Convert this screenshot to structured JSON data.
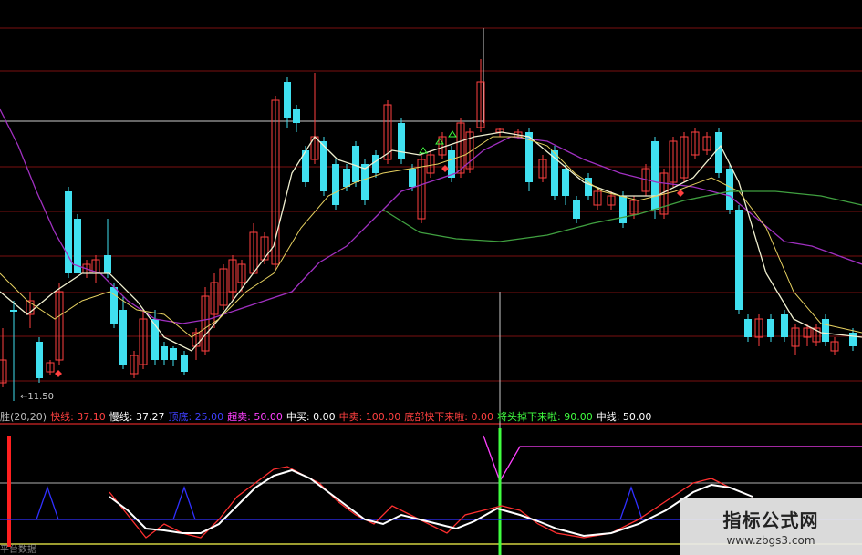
{
  "chart_data": {
    "type": "candlestick",
    "price_tag": "←11.50",
    "indicator_legend": [
      {
        "text": "胜(20,20)",
        "color": "#bbbbbb"
      },
      {
        "text": "快线: 37.10",
        "color": "#ff4040"
      },
      {
        "text": "慢线: 37.27",
        "color": "#ffffff"
      },
      {
        "text": "顶底: 25.00",
        "color": "#4040ff"
      },
      {
        "text": "超卖: 50.00",
        "color": "#ff40ff"
      },
      {
        "text": "中买: 0.00",
        "color": "#ffffff"
      },
      {
        "text": "中卖: 100.00",
        "color": "#ff4040"
      },
      {
        "text": "底部快下来啦: 0.00",
        "color": "#ff4040"
      },
      {
        "text": "将头掉下来啦: 90.00",
        "color": "#40ff40"
      },
      {
        "text": "中线: 50.00",
        "color": "#ffffff"
      }
    ],
    "bottom_label": "平台数据",
    "colors": {
      "up": "#ff4040",
      "down": "#40e0f0",
      "ma_white": "#f0f0d0",
      "ma_purple": "#a030c0",
      "ma_green": "#40a040"
    }
  },
  "watermark": {
    "title": "指标公式网",
    "url": "www.zbgs3.com"
  }
}
